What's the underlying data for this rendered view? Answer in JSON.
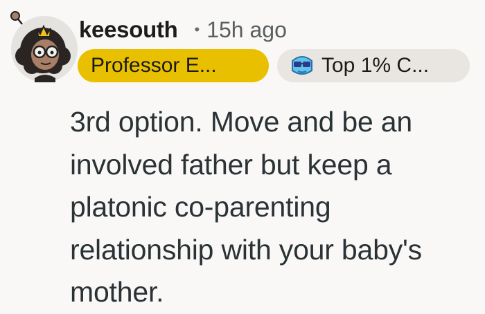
{
  "comment": {
    "avatar_icon": "user-avatar-icon",
    "username": "keesouth",
    "separator": "•",
    "timestamp": "15h ago",
    "flairs": {
      "primary": "Professor E...",
      "primary_color": "#e9c000",
      "award": "Top 1% C...",
      "award_icon": "sunglasses-emoji-icon",
      "award_color": "#e9e6e1"
    },
    "body": "3rd option. Move and be an involved father but keep a platonic co-parenting relationship with your baby's mother."
  }
}
